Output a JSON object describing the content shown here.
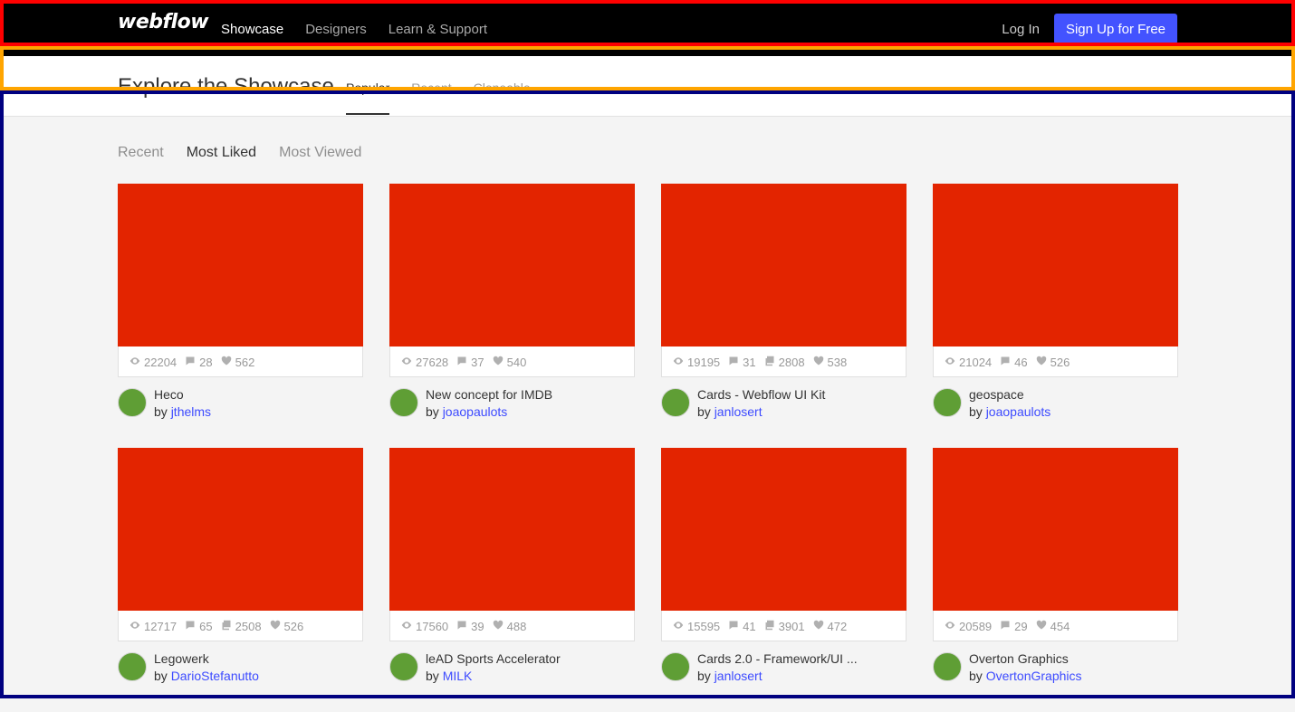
{
  "nav": {
    "logo": "webflow",
    "links": [
      "Showcase",
      "Designers",
      "Learn & Support"
    ],
    "login": "Log In",
    "signup": "Sign Up for Free"
  },
  "subheader": {
    "title": "Explore the Showcase",
    "tabs": [
      "Popular",
      "Recent",
      "Cloneable"
    ]
  },
  "filters": [
    "Recent",
    "Most Liked",
    "Most Viewed"
  ],
  "cards": [
    {
      "title": "Heco",
      "by": "by",
      "author": "jthelms",
      "views": "22204",
      "comments": "28",
      "clones": "",
      "likes": "562"
    },
    {
      "title": "New concept for IMDB",
      "by": "by",
      "author": "joaopaulots",
      "views": "27628",
      "comments": "37",
      "clones": "",
      "likes": "540"
    },
    {
      "title": "Cards - Webflow UI Kit",
      "by": "by",
      "author": "janlosert",
      "views": "19195",
      "comments": "31",
      "clones": "2808",
      "likes": "538"
    },
    {
      "title": "geospace",
      "by": "by",
      "author": "joaopaulots",
      "views": "21024",
      "comments": "46",
      "clones": "",
      "likes": "526"
    },
    {
      "title": "Legowerk",
      "by": "by",
      "author": "DarioStefanutto",
      "views": "12717",
      "comments": "65",
      "clones": "2508",
      "likes": "526"
    },
    {
      "title": "leAD Sports Accelerator",
      "by": "by",
      "author": "MILK",
      "views": "17560",
      "comments": "39",
      "clones": "",
      "likes": "488"
    },
    {
      "title": "Cards 2.0 - Framework/UI ...",
      "by": "by",
      "author": "janlosert",
      "views": "15595",
      "comments": "41",
      "clones": "3901",
      "likes": "472"
    },
    {
      "title": "Overton Graphics",
      "by": "by",
      "author": "OvertonGraphics",
      "views": "20589",
      "comments": "29",
      "clones": "",
      "likes": "454"
    }
  ],
  "colors": {
    "preview": "#e32400",
    "accent": "#4353ff",
    "avatar": "#5f9e35"
  }
}
